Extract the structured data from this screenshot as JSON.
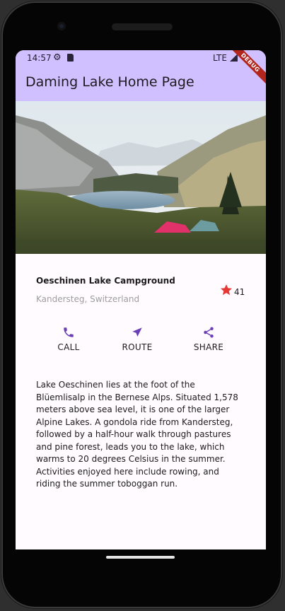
{
  "status_bar": {
    "time": "14:57",
    "network": "LTE",
    "icons": [
      "settings-gear-icon",
      "sim-card-icon",
      "signal-icon"
    ]
  },
  "app_bar": {
    "title": "Daming Lake Home Page",
    "background": "#d1c0ff",
    "debug_banner": "DEBUG"
  },
  "place": {
    "name": "Oeschinen Lake Campground",
    "location": "Kandersteg, Switzerland",
    "rating": "41",
    "star_color": "#e53935"
  },
  "actions": [
    {
      "label": "CALL",
      "icon": "phone-icon"
    },
    {
      "label": "ROUTE",
      "icon": "navigation-arrow-icon"
    },
    {
      "label": "SHARE",
      "icon": "share-icon"
    }
  ],
  "accent_color": "#6a3fb5",
  "description": "Lake Oeschinen lies at the foot of the Blüemlisalp in the Bernese Alps. Situated 1,578 meters above sea level, it is one of the larger Alpine Lakes. A gondola ride from Kandersteg, followed by a half-hour walk through pastures and pine forest, leads you to the lake, which warms to 20 degrees Celsius in the summer. Activities enjoyed here include rowing, and riding the summer toboggan run."
}
